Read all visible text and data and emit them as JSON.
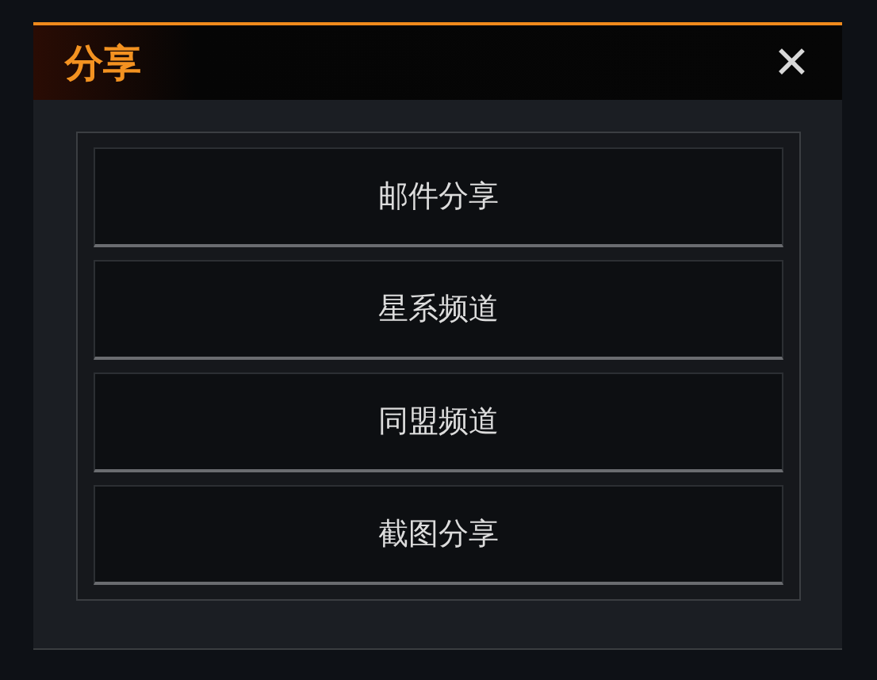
{
  "dialog": {
    "title": "分享",
    "close": "✕"
  },
  "options": [
    "邮件分享",
    "星系频道",
    "同盟频道",
    "截图分享"
  ]
}
